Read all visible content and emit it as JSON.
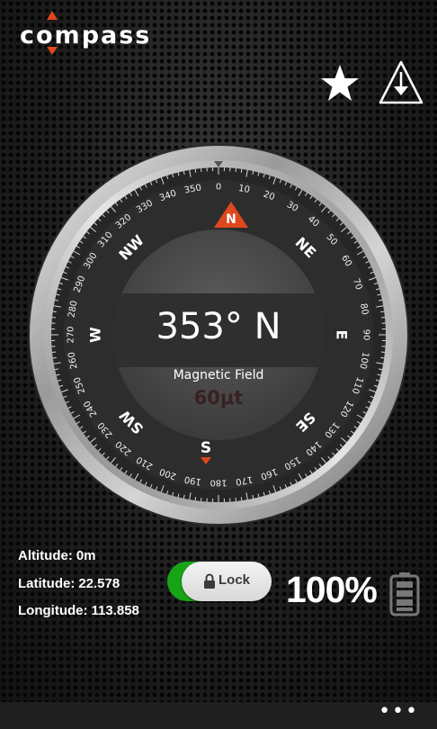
{
  "app": {
    "logo_text": "compass"
  },
  "toolbar": {
    "favorite_icon": "star-icon",
    "calibrate_icon": "calibrate-icon"
  },
  "compass": {
    "heading": "353° N",
    "field_label": "Magnetic Field",
    "field_value": "60μt",
    "marker_N": "N",
    "marker_S": "S",
    "cardinals": [
      "NE",
      "E",
      "SE",
      "SW",
      "W",
      "NW"
    ],
    "degree_labels": [
      "0",
      "10",
      "20",
      "30",
      "40",
      "50",
      "60",
      "70",
      "80",
      "90",
      "100",
      "110",
      "120",
      "130",
      "140",
      "150",
      "160",
      "170",
      "180",
      "190",
      "200",
      "210",
      "220",
      "230",
      "240",
      "250",
      "260",
      "270",
      "280",
      "290",
      "300",
      "310",
      "320",
      "330",
      "340",
      "350"
    ],
    "accent_color": "#e0471e"
  },
  "location": {
    "altitude_label": "Altitude:",
    "altitude_value": "0m",
    "latitude_label": "Latitude:",
    "latitude_value": "22.578",
    "longitude_label": "Longitude:",
    "longitude_value": "113.858"
  },
  "lock": {
    "label": "Lock",
    "enabled": true,
    "color": "#16a416"
  },
  "battery": {
    "percent": "100%"
  },
  "appbar": {
    "more": "•••"
  }
}
